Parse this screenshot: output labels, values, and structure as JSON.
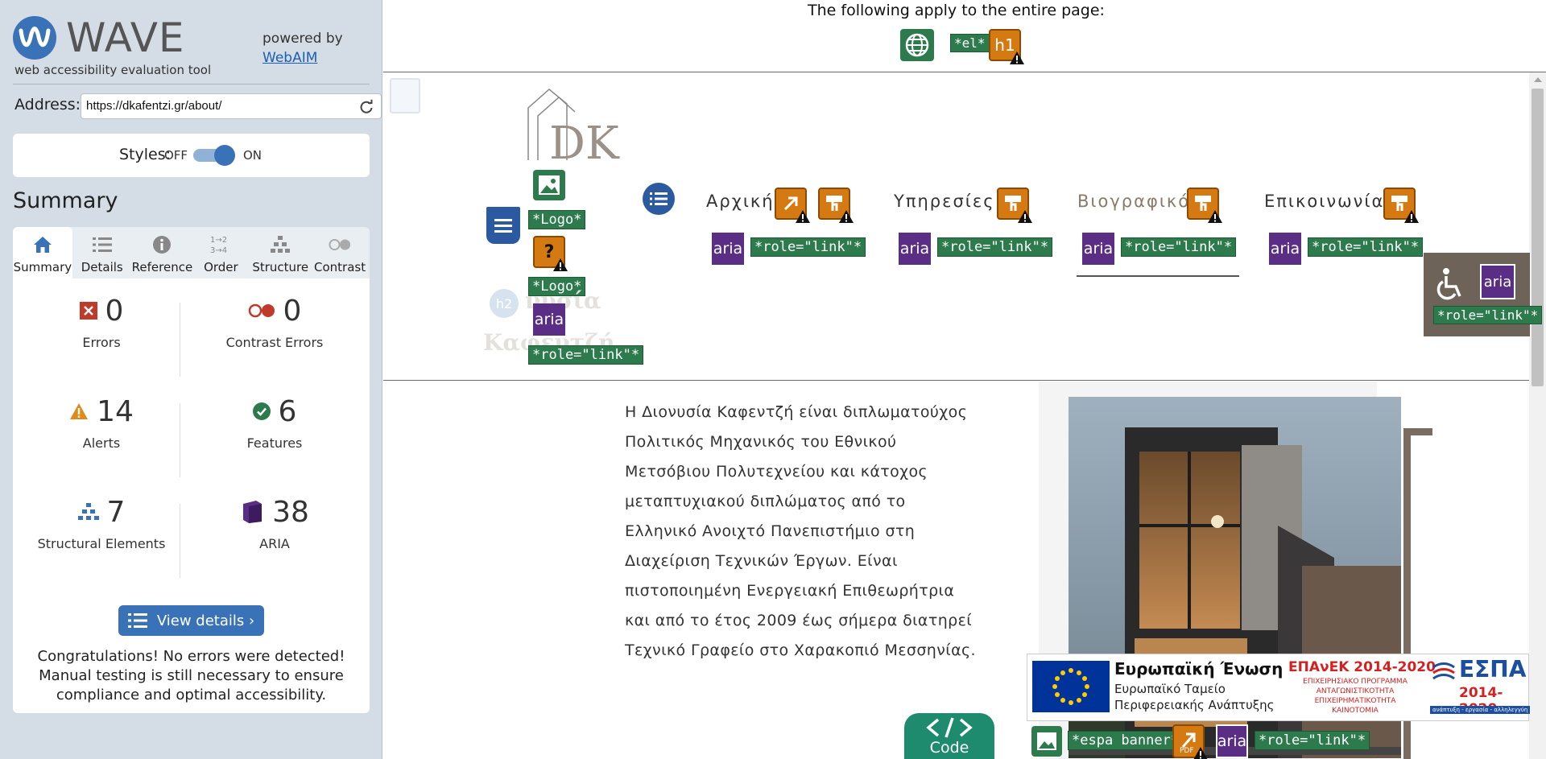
{
  "wave": {
    "title": "WAVE",
    "tagline": "web accessibility evaluation tool",
    "powered_by": "powered by",
    "webaim": "WebAIM",
    "address_label": "Address:",
    "address_value": "https://dkafentzi.gr/about/",
    "styles_label": "Styles:",
    "styles_off": "OFF",
    "styles_on": "ON",
    "summary_heading": "Summary",
    "tabs": [
      {
        "label": "Summary",
        "icon": "home-icon"
      },
      {
        "label": "Details",
        "icon": "list-icon"
      },
      {
        "label": "Reference",
        "icon": "info-icon"
      },
      {
        "label": "Order",
        "icon": "order-icon"
      },
      {
        "label": "Structure",
        "icon": "structure-icon"
      },
      {
        "label": "Contrast",
        "icon": "contrast-icon"
      }
    ],
    "stats": {
      "errors": {
        "value": "0",
        "label": "Errors"
      },
      "contrast_errors": {
        "value": "0",
        "label": "Contrast Errors"
      },
      "alerts": {
        "value": "14",
        "label": "Alerts"
      },
      "features": {
        "value": "6",
        "label": "Features"
      },
      "structural": {
        "value": "7",
        "label": "Structural Elements"
      },
      "aria": {
        "value": "38",
        "label": "ARIA"
      }
    },
    "view_details": "View details ›",
    "congrats": "Congratulations! No errors were detected! Manual testing is still necessary to ensure compliance and optimal accessibility.",
    "colors": {
      "accent": "#3a72b8",
      "panel": "#d4dde6",
      "error": "#c0392b",
      "alert": "#e08a1a",
      "feature": "#2d7a4c",
      "aria": "#5a2e84"
    }
  },
  "page": {
    "banner_text": "The following apply to the entire page:",
    "banner_el": "*el*",
    "banner_h1": "h1",
    "logo_label_1": "*Logo*",
    "logo_label_2": "*Logo*",
    "role_link": "*role=\"link\"*",
    "aria": "aria",
    "h2": "h2",
    "heading_faint_1": "νυσία",
    "heading_faint_2": "Καφεντζή",
    "nav": [
      "Αρχική",
      "Υπηρεσίες",
      "Βιογραφικό",
      "Επικοινωνία"
    ],
    "body_lines": [
      "Η Διονυσία Καφεντζή είναι διπλωματούχος",
      "Πολιτικός Μηχανικός του Εθνικού",
      "Μετσόβιου Πολυτεχνείου και κάτοχος",
      "μεταπτυχιακού διπλώματος από το",
      "Ελληνικό Ανοιχτό Πανεπιστήμιο στη",
      "Διαχείριση Τεχνικών Έργων. Είναι",
      "πιστοποιημένη Ενεργειακή Επιθεωρήτρια",
      "και από το έτος 2009 έως σήμερα διατηρεί",
      "Τεχνικό Γραφείο στο Χαρακοπιό Μεσσηνίας."
    ],
    "espa": {
      "eu_title": "Ευρωπαϊκή Ένωση",
      "eu_line1": "Ευρωπαϊκό Ταμείο",
      "eu_line2": "Περιφερειακής Ανάπτυξης",
      "epanek_title": "ΕΠΑνΕΚ 2014-2020",
      "epanek_line1": "ΕΠΙΧΕΙΡΗΣΙΑΚΟ ΠΡΟΓΡΑΜΜΑ",
      "epanek_line2": "ΑΝΤΑΓΩΝΙΣΤΙΚΟΤΗΤΑ",
      "epanek_line3": "ΕΠΙΧΕΙΡΗΜΑΤΙΚΟΤΗΤΑ",
      "epanek_line4": "ΚΑΙΝΟΤΟΜΙΑ",
      "espa_title": "ΕΣΠΑ",
      "espa_years": "2014-2020",
      "espa_motto": "ανάπτυξη - εργασία - αλληλεγγύη"
    },
    "espa_label": "*espa banner*",
    "code_label": "Code",
    "logo_letters": "DK"
  }
}
